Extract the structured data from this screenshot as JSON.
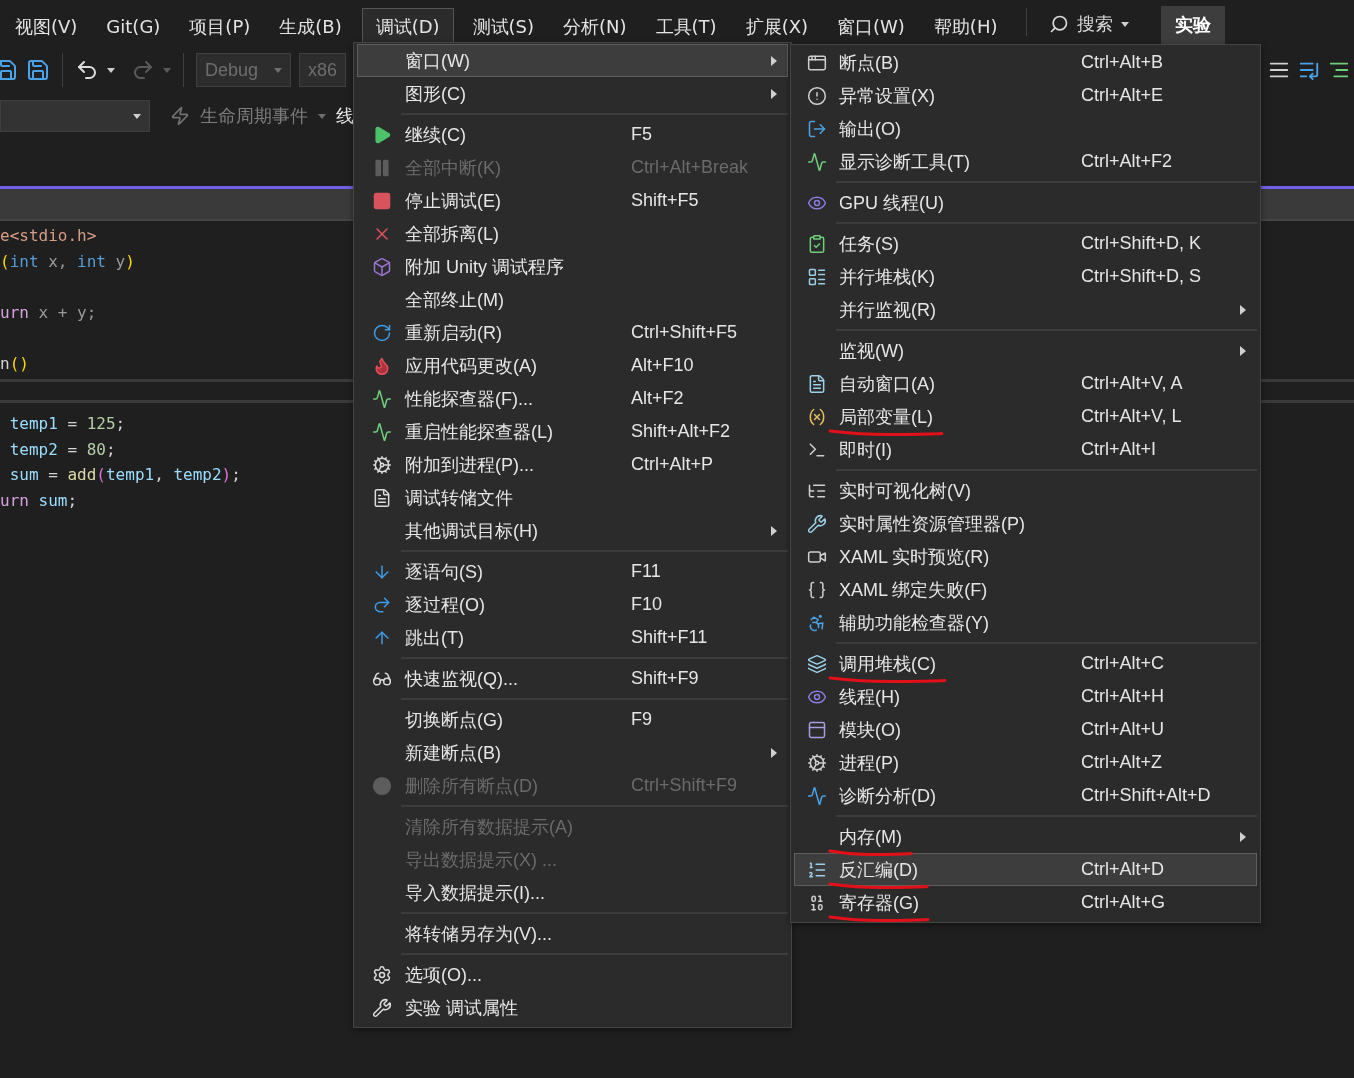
{
  "menu_bar": {
    "items": [
      {
        "label": "视图(V)",
        "selected": false
      },
      {
        "label": "Git(G)",
        "selected": false
      },
      {
        "label": "项目(P)",
        "selected": false
      },
      {
        "label": "生成(B)",
        "selected": false
      },
      {
        "label": "调试(D)",
        "selected": true
      },
      {
        "label": "测试(S)",
        "selected": false
      },
      {
        "label": "分析(N)",
        "selected": false
      },
      {
        "label": "工具(T)",
        "selected": false
      },
      {
        "label": "扩展(X)",
        "selected": false
      },
      {
        "label": "窗口(W)",
        "selected": false
      },
      {
        "label": "帮助(H)",
        "selected": false
      }
    ]
  },
  "search": {
    "label": "搜索"
  },
  "badge": "实验",
  "toolbar": {
    "configuration": {
      "label": "Debug",
      "disabled": true
    },
    "platform": {
      "label": "x86",
      "disabled": true
    }
  },
  "navigation": {
    "event_label": "生命周期事件",
    "cut_label": "线"
  },
  "code": {
    "top": [
      {
        "gap_before": false,
        "tokens": [
          {
            "text": "e<stdio.h>",
            "kind": "string"
          }
        ]
      },
      {
        "gap_before": false,
        "tokens": [
          {
            "text": "(",
            "kind": "bracket"
          },
          {
            "text": "int",
            "kind": "keyword"
          },
          {
            "text": " x, ",
            "kind": "param"
          },
          {
            "text": "int",
            "kind": "keyword"
          },
          {
            "text": " y",
            "kind": "param"
          },
          {
            "text": ")",
            "kind": "bracket"
          }
        ]
      },
      {
        "gap_before": true,
        "tokens": [
          {
            "text": "urn",
            "kind": "control"
          },
          {
            "text": " x + y;",
            "kind": "param"
          }
        ]
      },
      {
        "gap_before": true,
        "tokens": [
          {
            "text": "n",
            "kind": "plain"
          },
          {
            "text": "()",
            "kind": "bracket"
          }
        ]
      }
    ],
    "bottom": [
      {
        "tokens": [
          {
            "text": " temp1",
            "kind": "variable"
          },
          {
            "text": " = ",
            "kind": "plain"
          },
          {
            "text": "125",
            "kind": "number"
          },
          {
            "text": ";",
            "kind": "plain"
          }
        ]
      },
      {
        "tokens": [
          {
            "text": " temp2",
            "kind": "variable"
          },
          {
            "text": " = ",
            "kind": "plain"
          },
          {
            "text": "80",
            "kind": "number"
          },
          {
            "text": ";",
            "kind": "plain"
          }
        ]
      },
      {
        "tokens": [
          {
            "text": " sum",
            "kind": "variable"
          },
          {
            "text": " = ",
            "kind": "plain"
          },
          {
            "text": "add",
            "kind": "function"
          },
          {
            "text": "(",
            "kind": "bracket2"
          },
          {
            "text": "temp1",
            "kind": "variable"
          },
          {
            "text": ", ",
            "kind": "plain"
          },
          {
            "text": "temp2",
            "kind": "variable"
          },
          {
            "text": ")",
            "kind": "bracket2"
          },
          {
            "text": ";",
            "kind": "plain"
          }
        ]
      },
      {
        "tokens": [
          {
            "text": "urn",
            "kind": "control"
          },
          {
            "text": " sum",
            "kind": "variable"
          },
          {
            "text": ";",
            "kind": "plain"
          }
        ]
      }
    ]
  },
  "debug_menu": {
    "groups": [
      {
        "items": [
          {
            "label": "窗口(W)",
            "disabled": false,
            "submenu": true,
            "highlighted": true
          },
          {
            "label": "图形(C)",
            "disabled": false,
            "submenu": true,
            "highlighted": false
          }
        ]
      },
      {
        "items": [
          {
            "label": "继续(C)",
            "shortcut": "F5",
            "disabled": false,
            "submenu": false,
            "highlighted": false
          },
          {
            "label": "全部中断(K)",
            "shortcut": "Ctrl+Alt+Break",
            "disabled": true,
            "submenu": false,
            "highlighted": false
          },
          {
            "label": "停止调试(E)",
            "shortcut": "Shift+F5",
            "disabled": false,
            "submenu": false,
            "highlighted": false
          },
          {
            "label": "全部拆离(L)",
            "disabled": false,
            "submenu": false,
            "highlighted": false
          },
          {
            "label": "附加 Unity 调试程序",
            "disabled": false,
            "submenu": false,
            "highlighted": false
          },
          {
            "label": "全部终止(M)",
            "disabled": false,
            "submenu": false,
            "highlighted": false
          },
          {
            "label": "重新启动(R)",
            "shortcut": "Ctrl+Shift+F5",
            "disabled": false,
            "submenu": false,
            "highlighted": false
          },
          {
            "label": "应用代码更改(A)",
            "shortcut": "Alt+F10",
            "disabled": false,
            "submenu": false,
            "highlighted": false
          },
          {
            "label": "性能探查器(F)...",
            "shortcut": "Alt+F2",
            "disabled": false,
            "submenu": false,
            "highlighted": false
          },
          {
            "label": "重启性能探查器(L)",
            "shortcut": "Shift+Alt+F2",
            "disabled": false,
            "submenu": false,
            "highlighted": false
          },
          {
            "label": "附加到进程(P)...",
            "shortcut": "Ctrl+Alt+P",
            "disabled": false,
            "submenu": false,
            "highlighted": false
          },
          {
            "label": "调试转储文件",
            "disabled": false,
            "submenu": false,
            "highlighted": false
          },
          {
            "label": "其他调试目标(H)",
            "disabled": false,
            "submenu": true,
            "highlighted": false
          }
        ]
      },
      {
        "items": [
          {
            "label": "逐语句(S)",
            "shortcut": "F11",
            "disabled": false,
            "submenu": false,
            "highlighted": false
          },
          {
            "label": "逐过程(O)",
            "shortcut": "F10",
            "disabled": false,
            "submenu": false,
            "highlighted": false
          },
          {
            "label": "跳出(T)",
            "shortcut": "Shift+F11",
            "disabled": false,
            "submenu": false,
            "highlighted": false
          }
        ]
      },
      {
        "items": [
          {
            "label": "快速监视(Q)...",
            "shortcut": "Shift+F9",
            "disabled": false,
            "submenu": false,
            "highlighted": false
          }
        ]
      },
      {
        "items": [
          {
            "label": "切换断点(G)",
            "shortcut": "F9",
            "disabled": false,
            "submenu": false,
            "highlighted": false
          },
          {
            "label": "新建断点(B)",
            "disabled": false,
            "submenu": true,
            "highlighted": false
          },
          {
            "label": "删除所有断点(D)",
            "shortcut": "Ctrl+Shift+F9",
            "disabled": true,
            "submenu": false,
            "highlighted": false
          }
        ]
      },
      {
        "items": [
          {
            "label": "清除所有数据提示(A)",
            "disabled": true,
            "submenu": false,
            "highlighted": false
          },
          {
            "label": "导出数据提示(X) ...",
            "disabled": true,
            "submenu": false,
            "highlighted": false
          },
          {
            "label": "导入数据提示(I)...",
            "disabled": false,
            "submenu": false,
            "highlighted": false
          }
        ]
      },
      {
        "items": [
          {
            "label": "将转储另存为(V)...",
            "disabled": false,
            "submenu": false,
            "highlighted": false
          }
        ]
      },
      {
        "items": [
          {
            "label": "选项(O)...",
            "disabled": false,
            "submenu": false,
            "highlighted": false
          },
          {
            "label": "实验 调试属性",
            "disabled": false,
            "submenu": false,
            "highlighted": false
          }
        ]
      }
    ]
  },
  "window_submenu": {
    "groups": [
      {
        "items": [
          {
            "label": "断点(B)",
            "shortcut": "Ctrl+Alt+B",
            "submenu": false,
            "highlighted": false,
            "marked": false
          },
          {
            "label": "异常设置(X)",
            "shortcut": "Ctrl+Alt+E",
            "submenu": false,
            "highlighted": false,
            "marked": false
          },
          {
            "label": "输出(O)",
            "submenu": false,
            "highlighted": false,
            "marked": false
          },
          {
            "label": "显示诊断工具(T)",
            "shortcut": "Ctrl+Alt+F2",
            "submenu": false,
            "highlighted": false,
            "marked": false
          }
        ]
      },
      {
        "items": [
          {
            "label": "GPU 线程(U)",
            "submenu": false,
            "highlighted": false,
            "marked": false
          }
        ]
      },
      {
        "items": [
          {
            "label": "任务(S)",
            "shortcut": "Ctrl+Shift+D, K",
            "submenu": false,
            "highlighted": false,
            "marked": false
          },
          {
            "label": "并行堆栈(K)",
            "shortcut": "Ctrl+Shift+D, S",
            "submenu": false,
            "highlighted": false,
            "marked": false
          },
          {
            "label": "并行监视(R)",
            "submenu": true,
            "highlighted": false,
            "marked": false
          }
        ]
      },
      {
        "items": [
          {
            "label": "监视(W)",
            "submenu": true,
            "highlighted": false,
            "marked": false
          },
          {
            "label": "自动窗口(A)",
            "shortcut": "Ctrl+Alt+V, A",
            "submenu": false,
            "highlighted": false,
            "marked": false
          },
          {
            "label": "局部变量(L)",
            "shortcut": "Ctrl+Alt+V, L",
            "submenu": false,
            "highlighted": false,
            "marked": true
          },
          {
            "label": "即时(I)",
            "shortcut": "Ctrl+Alt+I",
            "submenu": false,
            "highlighted": false,
            "marked": false
          }
        ]
      },
      {
        "items": [
          {
            "label": "实时可视化树(V)",
            "submenu": false,
            "highlighted": false,
            "marked": false
          },
          {
            "label": "实时属性资源管理器(P)",
            "submenu": false,
            "highlighted": false,
            "marked": false
          },
          {
            "label": "XAML 实时预览(R)",
            "submenu": false,
            "highlighted": false,
            "marked": false
          },
          {
            "label": "XAML 绑定失败(F)",
            "submenu": false,
            "highlighted": false,
            "marked": false
          },
          {
            "label": "辅助功能检查器(Y)",
            "submenu": false,
            "highlighted": false,
            "marked": false
          }
        ]
      },
      {
        "items": [
          {
            "label": "调用堆栈(C)",
            "shortcut": "Ctrl+Alt+C",
            "submenu": false,
            "highlighted": false,
            "marked": true
          },
          {
            "label": "线程(H)",
            "shortcut": "Ctrl+Alt+H",
            "submenu": false,
            "highlighted": false,
            "marked": false
          },
          {
            "label": "模块(O)",
            "shortcut": "Ctrl+Alt+U",
            "submenu": false,
            "highlighted": false,
            "marked": false
          },
          {
            "label": "进程(P)",
            "shortcut": "Ctrl+Alt+Z",
            "submenu": false,
            "highlighted": false,
            "marked": false
          },
          {
            "label": "诊断分析(D)",
            "shortcut": "Ctrl+Shift+Alt+D",
            "submenu": false,
            "highlighted": false,
            "marked": false
          }
        ]
      },
      {
        "items": [
          {
            "label": "内存(M)",
            "submenu": true,
            "highlighted": false,
            "marked": true
          },
          {
            "label": "反汇编(D)",
            "shortcut": "Ctrl+Alt+D",
            "submenu": false,
            "highlighted": true,
            "marked": true
          },
          {
            "label": "寄存器(G)",
            "shortcut": "Ctrl+Alt+G",
            "submenu": false,
            "highlighted": false,
            "marked": true
          }
        ]
      }
    ]
  }
}
